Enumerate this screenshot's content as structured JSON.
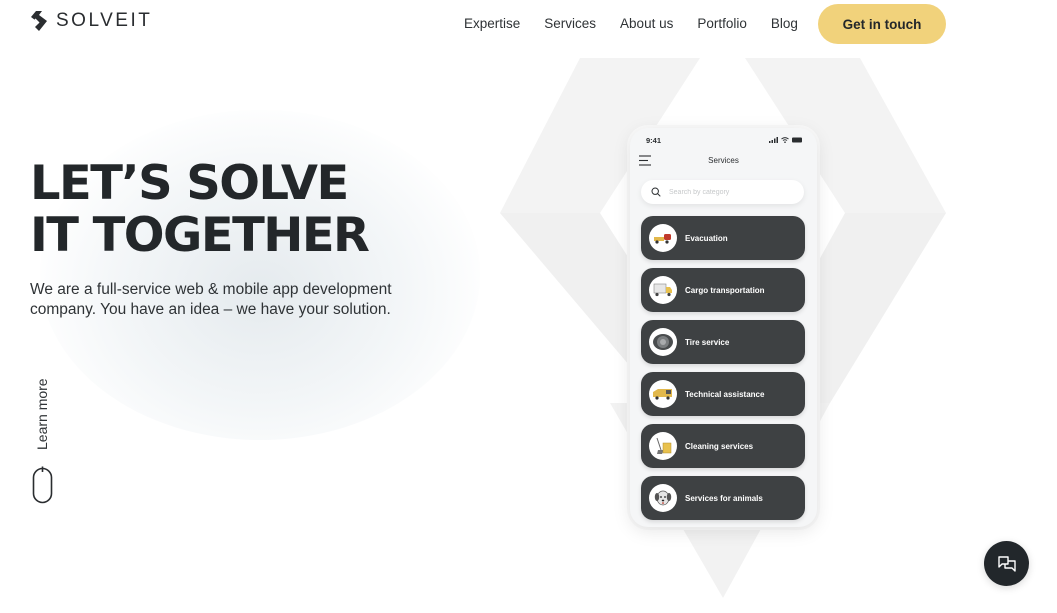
{
  "brand": {
    "name": "SOLVEIT",
    "accent": "#f1d27b",
    "dark": "#23272a"
  },
  "nav": {
    "items": [
      {
        "label": "Expertise"
      },
      {
        "label": "Services"
      },
      {
        "label": "About us"
      },
      {
        "label": "Portfolio"
      },
      {
        "label": "Blog"
      }
    ],
    "cta_label": "Get in touch"
  },
  "hero": {
    "title_line1": "LET’S SOLVE",
    "title_line2": "IT TOGETHER",
    "subtitle": "We are a full-service web & mobile app development company. You have an idea – we have your solution.",
    "learn_more": "Learn more"
  },
  "phone": {
    "time": "9:41",
    "title": "Services",
    "search_placeholder": "Search by category",
    "services": [
      {
        "label": "Evacuation",
        "icon": "tow-truck-icon"
      },
      {
        "label": "Cargo transportation",
        "icon": "cargo-truck-icon"
      },
      {
        "label": "Tire service",
        "icon": "tire-icon"
      },
      {
        "label": "Technical assistance",
        "icon": "service-van-icon"
      },
      {
        "label": "Cleaning services",
        "icon": "cleaning-bucket-icon"
      },
      {
        "label": "Services for animals",
        "icon": "dog-icon"
      }
    ]
  },
  "chat": {
    "icon": "chat-bubbles-icon"
  }
}
